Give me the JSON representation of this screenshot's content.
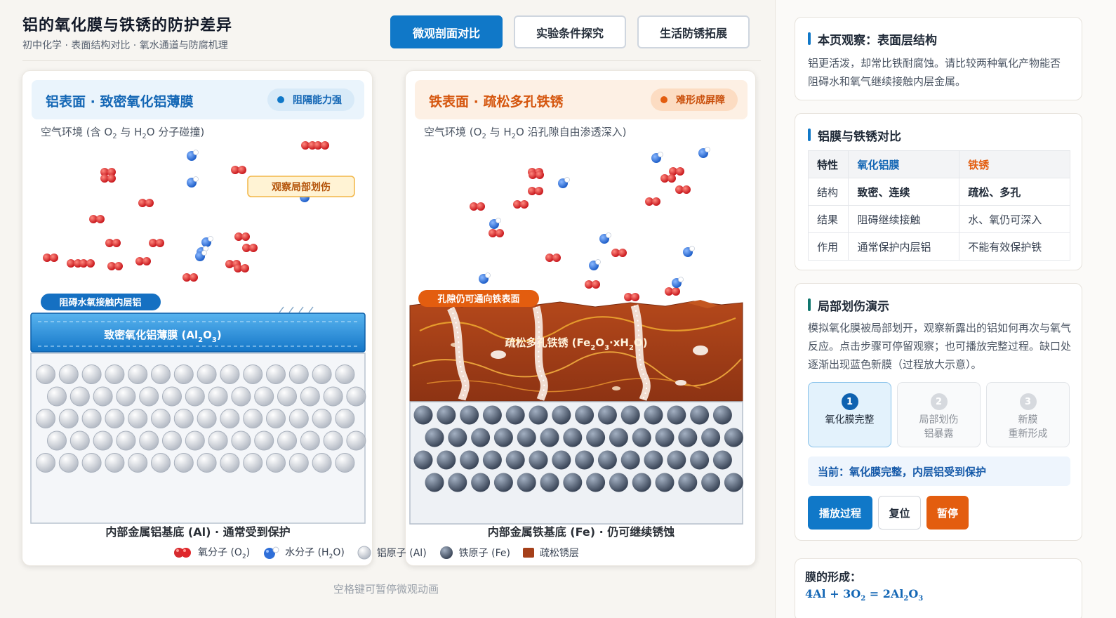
{
  "header": {
    "title": "铝的氧化膜与铁锈的防护差异",
    "subtitle": "初中化学 · 表面结构对比 · 氧水通道与防腐机理",
    "tabs": [
      {
        "label": "微观剖面对比",
        "active": true
      },
      {
        "label": "实验条件探究",
        "active": false
      },
      {
        "label": "生活防锈拓展",
        "active": false
      }
    ]
  },
  "aluminum_panel": {
    "title": "铝表面 · 致密氧化铝薄膜",
    "badge": "阻隔能力强",
    "env_prefix": "空气环境 (含 O",
    "env_mid1": " 与 H",
    "env_mid2": "O 分子碰撞)",
    "scratch_tag": "观察局部划伤",
    "barrier_tag": "阻碍水氧接触内层铝",
    "film_label": "致密氧化铝薄膜 (Al",
    "film_close": ")",
    "base_caption": "内部金属铝基底 (Al) · 通常受到保护"
  },
  "iron_panel": {
    "title": "铁表面 · 疏松多孔铁锈",
    "badge": "难形成屏障",
    "env_prefix": "空气环境 (O",
    "env_mid1": " 与 H",
    "env_mid2": "O 沿孔隙自由渗透深入)",
    "pore_tag": "孔隙仍可通向铁表面",
    "rust_label": "疏松多孔铁锈 (Fe",
    "rust_mid": "·xH",
    "rust_close": "O)",
    "base_caption": "内部金属铁基底 (Fe) · 仍可继续锈蚀"
  },
  "legend": {
    "o2": "氧分子 (O",
    "o2_close": ")",
    "h2o": "水分子 (H",
    "h2o_close": "O)",
    "al": "铝原子 (Al)",
    "fe": "铁原子 (Fe)",
    "rust": "疏松锈层"
  },
  "hint": "空格键可暂停微观动画",
  "side": {
    "card1": {
      "title": "本页观察：表面层结构",
      "body": "铝更活泼，却常比铁耐腐蚀。请比较两种氧化产物能否阻碍水和氧气继续接触内层金属。"
    },
    "card2": {
      "title": "铝膜与铁锈对比",
      "headers": [
        "特性",
        "氧化铝膜",
        "铁锈"
      ],
      "rows": [
        [
          "结构",
          "致密、连续",
          "疏松、多孔"
        ],
        [
          "结果",
          "阻碍继续接触",
          "水、氧仍可深入"
        ],
        [
          "作用",
          "通常保护内层铝",
          "不能有效保护铁"
        ]
      ]
    },
    "card3": {
      "title": "局部划伤演示",
      "body": "模拟氧化膜被局部划开，观察新露出的铝如何再次与氧气反应。点击步骤可停留观察；也可播放完整过程。缺口处逐渐出现蓝色新膜（过程放大示意）。",
      "steps": [
        {
          "num": "1",
          "line1": "氧化膜完整",
          "line2": "",
          "active": true
        },
        {
          "num": "2",
          "line1": "局部划伤",
          "line2": "铝暴露",
          "active": false
        },
        {
          "num": "3",
          "line1": "新膜",
          "line2": "重新形成",
          "active": false
        }
      ],
      "status": "当前：氧化膜完整，内层铝受到保护",
      "buttons": {
        "play": "播放过程",
        "reset": "复位",
        "pause": "暂停"
      }
    },
    "card4": {
      "label": "膜的形成：",
      "formula_parts": [
        "4Al + 3O",
        "2",
        " = 2Al",
        "2",
        "O",
        "3"
      ]
    }
  },
  "colors": {
    "accent": "#1078c8",
    "iron_accent": "#e35d0f",
    "rust": "#a5401a",
    "oxygen": "#e0262a",
    "water": "#2f6fd8"
  }
}
